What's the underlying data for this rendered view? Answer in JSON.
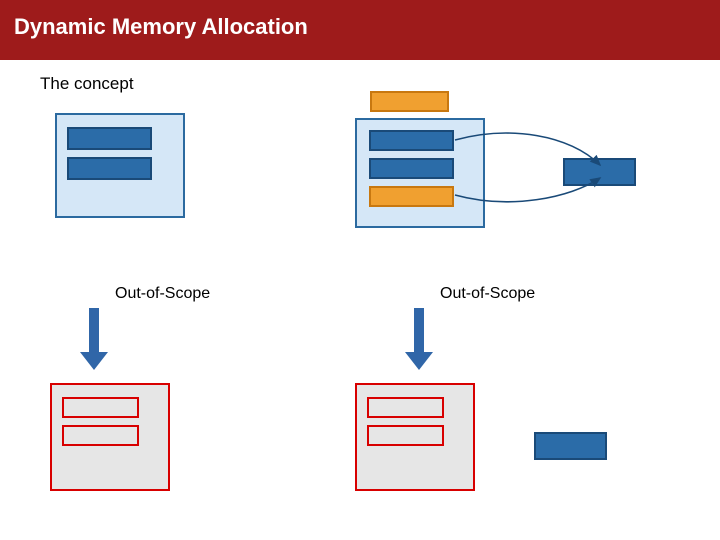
{
  "title": "Dynamic Memory Allocation",
  "subtitle": "The concept",
  "labels": {
    "oos_left": "Out-of-Scope",
    "oos_right": "Out-of-Scope"
  },
  "colors": {
    "brand": "#9e1b1b",
    "container_active_fill": "#d5e7f7",
    "container_active_border": "#2b6aa0",
    "container_dead_border": "#d80000",
    "slot_fill": "#2b6ca8",
    "slot_orange": "#f0a030",
    "arrow": "#3066a8"
  },
  "diagram": {
    "top_left_container": {
      "slots": [
        "filled",
        "filled"
      ]
    },
    "top_right_container": {
      "above": "orange",
      "slots": [
        "filled",
        "filled",
        "orange"
      ]
    },
    "top_right_heap_target": "filled",
    "bottom_left_container": {
      "state": "dead",
      "slots": [
        "empty",
        "empty"
      ]
    },
    "bottom_right_container": {
      "state": "dead",
      "slots": [
        "empty",
        "empty"
      ]
    },
    "bottom_right_heap_leftover": "filled"
  }
}
